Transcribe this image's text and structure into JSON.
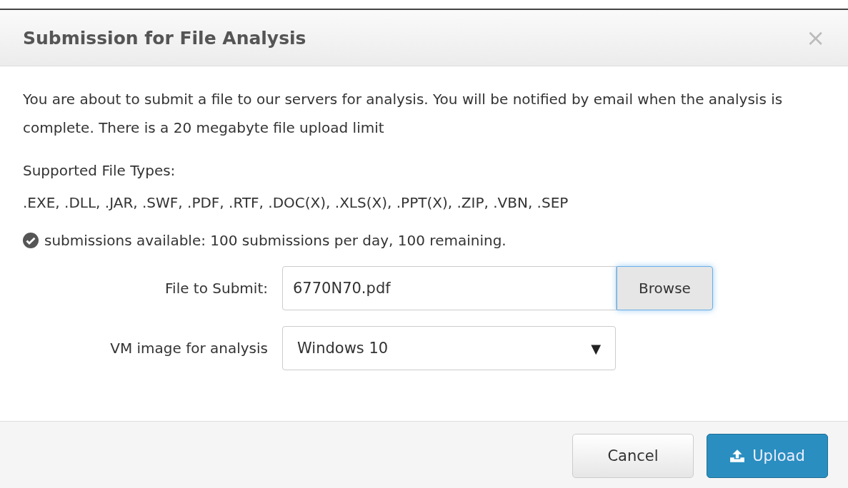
{
  "dialog": {
    "title": "Submission for File Analysis",
    "close": "×"
  },
  "body": {
    "intro": "You are about to submit a file to our servers for analysis. You will be notified by email when the analysis is complete. There is a 20 megabyte file upload limit",
    "types_label": "Supported File Types:",
    "types": ".EXE, .DLL, .JAR, .SWF, .PDF, .RTF, .DOC(X), .XLS(X), .PPT(X), .ZIP, .VBN, .SEP",
    "status": "submissions available: 100 submissions per day, 100 remaining."
  },
  "form": {
    "file": {
      "label": "File to Submit:",
      "value": "6770N70.pdf",
      "browse": "Browse"
    },
    "vm": {
      "label": "VM image for analysis",
      "value": "Windows 10",
      "arrow": "▼"
    }
  },
  "buttons": [
    {
      "label": "Cancel",
      "kind": "default"
    },
    {
      "label": "Upload",
      "kind": "primary"
    }
  ]
}
